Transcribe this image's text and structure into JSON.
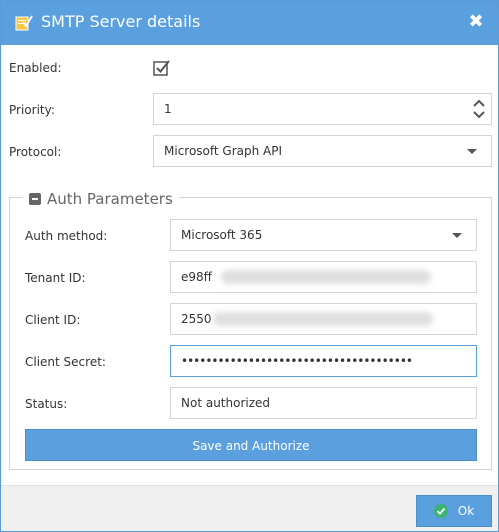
{
  "dialog": {
    "title": "SMTP Server details",
    "close_glyph": "✖"
  },
  "general": {
    "enabled_label": "Enabled:",
    "enabled_checked": true,
    "priority_label": "Priority:",
    "priority_value": "1",
    "protocol_label": "Protocol:",
    "protocol_value": "Microsoft Graph API"
  },
  "auth": {
    "legend": "Auth Parameters",
    "method_label": "Auth method:",
    "method_value": "Microsoft 365",
    "tenant_label": "Tenant ID:",
    "tenant_value": "e98ff",
    "client_id_label": "Client ID:",
    "client_id_value": "2550",
    "secret_label": "Client Secret:",
    "secret_value": "••••••••••••••••••••••••••••••••••••••",
    "status_label": "Status:",
    "status_value": "Not authorized",
    "save_button": "Save and Authorize"
  },
  "footer": {
    "ok_label": "Ok"
  },
  "icons": {
    "title": "checklist-icon",
    "close": "close-icon",
    "enabled": "checkmark-icon",
    "spinner": "spinner-arrows-icon",
    "dropdown": "chevron-down-icon",
    "collapse": "minus-icon",
    "ok": "check-circle-icon"
  },
  "colors": {
    "accent": "#5ba0de",
    "ok_icon": "#3cb371"
  }
}
